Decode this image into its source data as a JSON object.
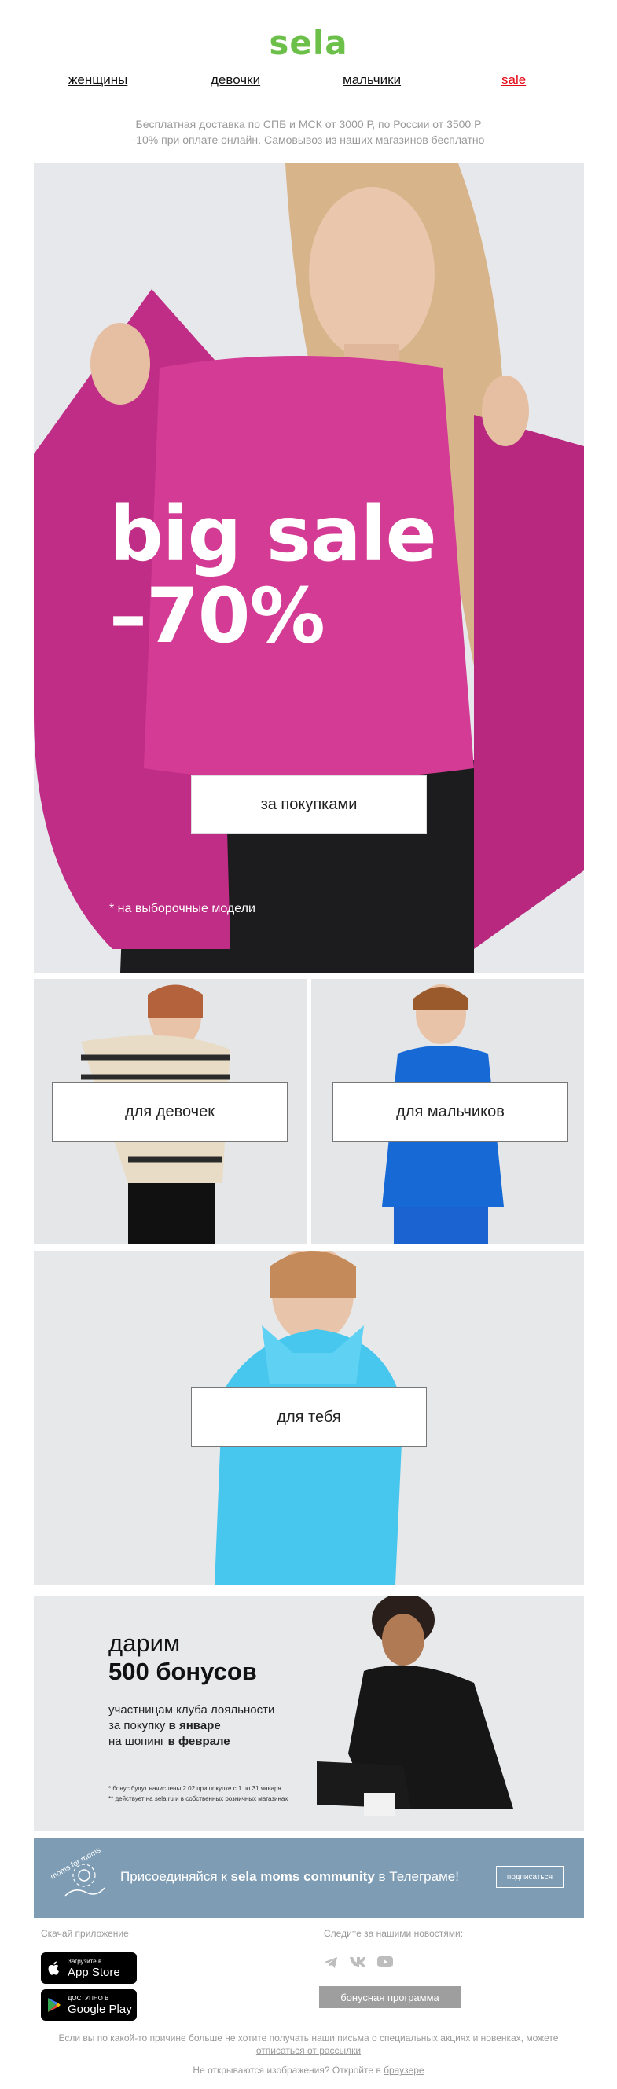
{
  "brand": "sela",
  "nav": {
    "women": "женщины",
    "girls": "девочки",
    "boys": "мальчики",
    "sale": "sale"
  },
  "shipping": {
    "line1": "Бесплатная доставка по СПБ и МСК от 3000 Р, по России от 3500 Р",
    "line2": "-10% при оплате онлайн. Самовывоз из наших магазинов бесплатно"
  },
  "hero": {
    "title_line1": "big sale",
    "title_line2": "–70%",
    "button": "за покупками",
    "note": "* на выборочные модели"
  },
  "categories": {
    "girls": "для девочек",
    "boys": "для мальчиков",
    "you": "для тебя"
  },
  "bonus": {
    "line1": "дарим",
    "line2": "500 бонусов",
    "desc1": "участницам клуба лояльности",
    "desc2_pre": "за покупку ",
    "desc2_bold": "в январе",
    "desc3_pre": "на шопинг ",
    "desc3_bold": "в феврале",
    "foot1": "* бонус будут начислены 2.02 при покупке с 1 по 31 января",
    "foot2": "** действует на sela.ru и в собственных розничных магазинах"
  },
  "telegram": {
    "badge": "moms for moms",
    "text_pre": "Присоединяйся к ",
    "text_bold": "sela moms community",
    "text_post": " в Телеграме!",
    "button": "подписаться"
  },
  "footer": {
    "download": "Скачай приложение",
    "follow": "Следите за нашими новостями:",
    "appstore_small": "Загрузите в",
    "appstore_big": "App Store",
    "gplay_small": "ДОСТУПНО В",
    "gplay_big": "Google Play",
    "loyalty_button": "бонусная программа",
    "unsub_line1": "Если вы по какой-то причине больше не хотите получать наши письма о специальных акциях и новенках, можете",
    "unsub_link": "отписаться от рассылки",
    "browser_pre": "Не открываются изображения? Откройте в ",
    "browser_link": "браузере"
  }
}
